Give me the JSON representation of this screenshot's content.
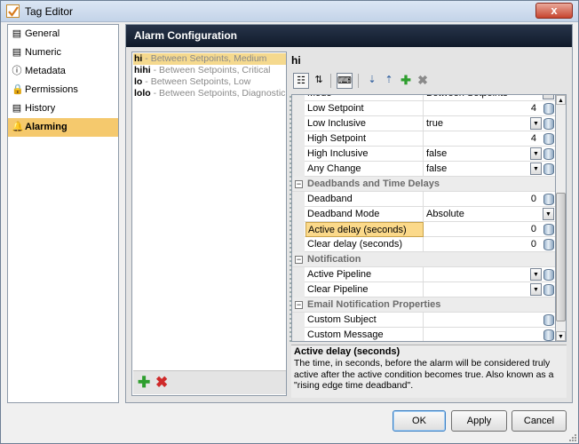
{
  "window": {
    "title": "Tag Editor",
    "close_label": "x"
  },
  "nav": {
    "items": [
      {
        "label": "General",
        "icon": "page-icon",
        "glyph": "▤"
      },
      {
        "label": "Numeric",
        "icon": "page-icon",
        "glyph": "▤"
      },
      {
        "label": "Metadata",
        "icon": "info-icon",
        "glyph": "ⓘ"
      },
      {
        "label": "Permissions",
        "icon": "lock-icon",
        "glyph": "🔒"
      },
      {
        "label": "History",
        "icon": "history-page-icon",
        "glyph": "▤"
      },
      {
        "label": "Alarming",
        "icon": "bell-icon",
        "glyph": "🔔"
      }
    ],
    "selected": "Alarming"
  },
  "main": {
    "header": "Alarm Configuration"
  },
  "alarms": {
    "items": [
      {
        "name": "hi",
        "sep": " - ",
        "desc": "Between Setpoints, Medium"
      },
      {
        "name": "hihi",
        "sep": " - ",
        "desc": "Between Setpoints, Critical"
      },
      {
        "name": "lo",
        "sep": " - ",
        "desc": "Between Setpoints, Low"
      },
      {
        "name": "lolo",
        "sep": " - ",
        "desc": "Between Setpoints, Diagnostic"
      }
    ],
    "add_glyph": "✚",
    "remove_glyph": "✖"
  },
  "detail": {
    "title": "hi",
    "toolbar": {
      "categorized": "☷",
      "alpha": "⇅",
      "keyboard": "⌨",
      "expand": "⇣",
      "collapse": "⇡",
      "add": "✚",
      "remove": "✖"
    },
    "rows": [
      {
        "name": "Mode",
        "value": "Between Setpoints",
        "combo": true,
        "bind": false,
        "num": false
      },
      {
        "name": "Low Setpoint",
        "value": "4",
        "combo": false,
        "bind": true,
        "num": true
      },
      {
        "name": "Low Inclusive",
        "value": "true",
        "combo": true,
        "bind": true,
        "num": false
      },
      {
        "name": "High Setpoint",
        "value": "4",
        "combo": false,
        "bind": true,
        "num": true
      },
      {
        "name": "High Inclusive",
        "value": "false",
        "combo": true,
        "bind": true,
        "num": false
      },
      {
        "name": "Any Change",
        "value": "false",
        "combo": true,
        "bind": true,
        "num": false
      },
      {
        "category": "Deadbands and Time Delays"
      },
      {
        "name": "Deadband",
        "value": "0",
        "combo": false,
        "bind": true,
        "num": true
      },
      {
        "name": "Deadband Mode",
        "value": "Absolute",
        "combo": true,
        "bind": false,
        "num": false
      },
      {
        "name": "Active delay (seconds)",
        "value": "0",
        "combo": false,
        "bind": true,
        "num": true,
        "selected": true
      },
      {
        "name": "Clear delay (seconds)",
        "value": "0",
        "combo": false,
        "bind": true,
        "num": true
      },
      {
        "category": "Notification"
      },
      {
        "name": "Active Pipeline",
        "value": "",
        "combo": true,
        "bind": true,
        "num": false
      },
      {
        "name": "Clear Pipeline",
        "value": "",
        "combo": true,
        "bind": true,
        "num": false
      },
      {
        "category": "Email Notification Properties"
      },
      {
        "name": "Custom Subject",
        "value": "",
        "combo": false,
        "bind": true,
        "num": false
      },
      {
        "name": "Custom Message",
        "value": "",
        "combo": false,
        "bind": true,
        "num": false
      }
    ],
    "description": {
      "title": "Active delay (seconds)",
      "text": "The time, in seconds, before the alarm will be considered truly active after the active condition becomes true. Also known as a \"rising edge time deadband\"."
    }
  },
  "buttons": {
    "ok": "OK",
    "apply": "Apply",
    "cancel": "Cancel"
  },
  "glyphs": {
    "combo_arrow": "▼",
    "scroll_up": "▲",
    "scroll_down": "▼",
    "category_toggle": "−"
  }
}
